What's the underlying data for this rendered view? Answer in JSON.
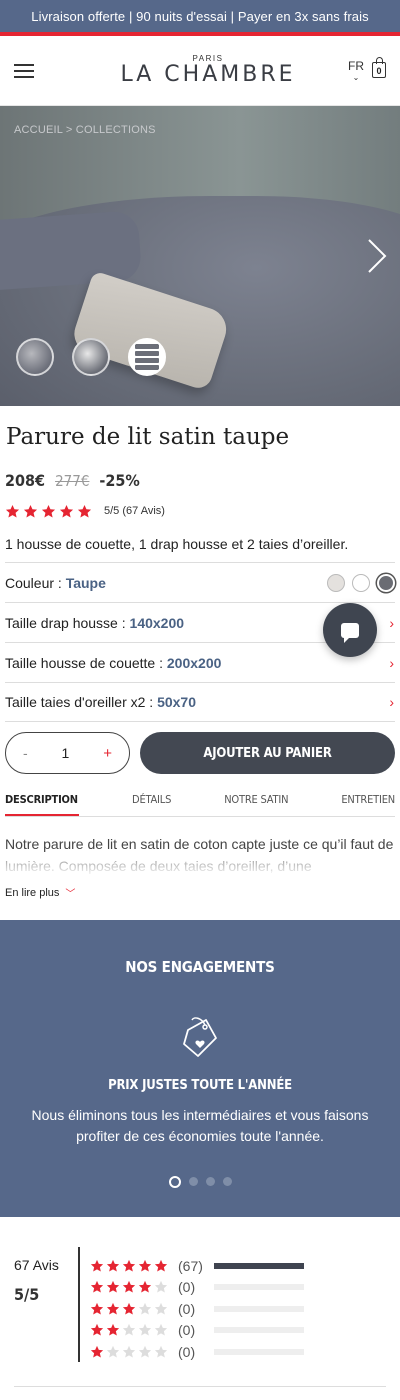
{
  "promo": {
    "text": "Livraison offerte | 90 nuits d'essai | Payer en 3x sans frais"
  },
  "header": {
    "menu_icon": "hamburger-icon",
    "logo_small": "PARIS",
    "logo_name": "LA CHAMBRE",
    "language": "FR",
    "cart_count": "0",
    "cart_icon": "shopping-bag-icon"
  },
  "hero": {
    "breadcrumb": "ACCUEIL > COLLECTIONS",
    "next_icon": "chevron-right-icon"
  },
  "product": {
    "title": "Parure de lit satin taupe",
    "price": "208€",
    "old_price": "277€",
    "discount": "-25%",
    "rating": 5,
    "rating_text": "5/5 (67 Avis)",
    "description": "1 housse de couette, 1 drap housse et 2 taies d’oreiller."
  },
  "options": [
    {
      "label": "Couleur : ",
      "value": "Taupe"
    },
    {
      "label": "Taille drap housse : ",
      "value": "140x200"
    },
    {
      "label": "Taille housse de couette : ",
      "value": "200x200"
    },
    {
      "label": "Taille taies d'oreiller x2 : ",
      "value": "50x70"
    }
  ],
  "quantity": {
    "minus": "-",
    "value": "1",
    "plus": "+"
  },
  "add_to_cart": "AJOUTER AU PANIER",
  "tabs": [
    {
      "label": "DESCRIPTION"
    },
    {
      "label": "DÉTAILS"
    },
    {
      "label": "NOTRE SATIN"
    },
    {
      "label": "ENTRETIEN"
    }
  ],
  "tab_content": "Notre parure de lit en satin de coton capte juste ce qu’il faut de lumière. Composée de deux taies d’oreiller, d’une",
  "read_more": "En lire plus",
  "engagements": {
    "title": "NOS ENGAGEMENTS",
    "icon": "price-tag-heart-icon",
    "subtitle": "PRIX JUSTES TOUTE L'ANNÉE",
    "text": "Nous éliminons tous les intermédiaires et vous faisons profiter de ces économies toute l'année.",
    "slides": 4,
    "active_slide": 0
  },
  "reviews": {
    "count": "67 Avis",
    "score": "5/5",
    "breakdown": [
      {
        "stars": 5,
        "count": "(67)",
        "fraction": 1.0
      },
      {
        "stars": 4,
        "count": "(0)",
        "fraction": 0
      },
      {
        "stars": 3,
        "count": "(0)",
        "fraction": 0
      },
      {
        "stars": 2,
        "count": "(0)",
        "fraction": 0
      },
      {
        "stars": 1,
        "count": "(0)",
        "fraction": 0
      }
    ]
  },
  "colors": {
    "brand_blue": "#56688a",
    "accent_red": "#e52532",
    "dark": "#434852",
    "link_blue": "#4a6284"
  }
}
